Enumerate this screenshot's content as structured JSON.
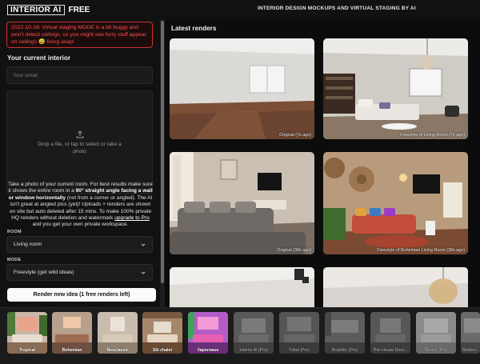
{
  "header": {
    "logo_main": "INTERIOR AI",
    "logo_free": "FREE",
    "tagline": "INTERIOR DESIGN MOCKUPS AND VIRTUAL STAGING BY AI"
  },
  "alert": {
    "text": "2022-10-18: Virtual staging MODE is a bit buggy and won't detect ceilings, so you might see furry stuff appear on ceilings 😅 fixing asap!"
  },
  "form": {
    "title": "Your current interior",
    "email_placeholder": "Your email",
    "dropzone_text": "Drop a file, or tap to select or take a photo",
    "desc_1": "Take a photo of your current room. For best results make sure it shows the entire room in a ",
    "desc_bold": "90° straight angle facing a wall or window horizontally",
    "desc_2": " (not from a corner or angled). The AI isn't great at angled pics (yet)! Uploads + renders are shown on site but auto deleted after 15 mins. To make 100% private HQ renders without deletion and watermark ",
    "desc_link": "upgrade to Pro",
    "desc_3": " and you get your own private workspace.",
    "room_label": "ROOM",
    "room_value": "Living room",
    "mode_label": "MODE",
    "mode_value": "Freestyle (get wild ideas)",
    "render_button": "Render new idea (1 free renders left)"
  },
  "renders": {
    "title": "Latest renders",
    "items": [
      {
        "caption": "Original (7s ago)"
      },
      {
        "caption": "Freestyle of Living Room (7s ago)"
      },
      {
        "caption": "Original (38s ago)"
      },
      {
        "caption": "Freestyle of Bohemian Living Room (38s ago)"
      },
      {
        "caption": ""
      },
      {
        "caption": ""
      }
    ]
  },
  "styles": [
    {
      "label": "Tropical",
      "locked": false
    },
    {
      "label": "Bohemian",
      "locked": false
    },
    {
      "label": "Neoclassic",
      "locked": false
    },
    {
      "label": "Ski chalet",
      "locked": false
    },
    {
      "label": "Vaporwave",
      "locked": false
    },
    {
      "label": "Interior AI (Pro)",
      "locked": true
    },
    {
      "label": "Tribal (Pro)",
      "locked": true
    },
    {
      "label": "Biophilic (Pro)",
      "locked": true
    },
    {
      "label": "This House Does...",
      "locked": true
    },
    {
      "label": "Sketch (Pro)",
      "locked": true
    },
    {
      "label": "Modern",
      "locked": true
    }
  ],
  "colors": {
    "alert": "#ff4d4d",
    "background": "#0b0b0b",
    "panel": "#111111",
    "button": "#fafafa"
  },
  "icons": [
    "upload-icon",
    "chevron-down-icon"
  ]
}
